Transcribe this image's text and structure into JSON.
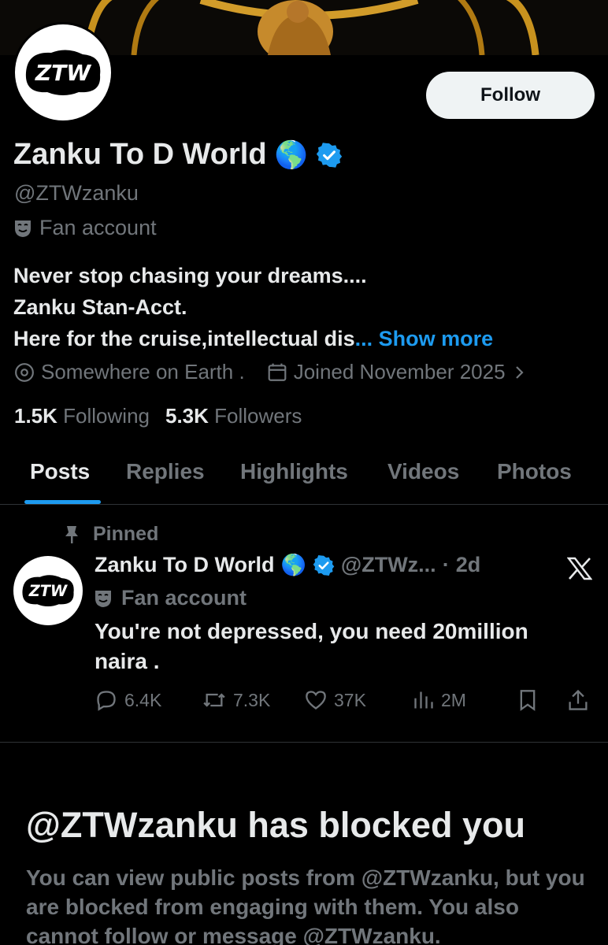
{
  "profile": {
    "display_name": "Zanku To D World",
    "name_emoji": "🌎",
    "handle": "@ZTWzanku",
    "category": "Fan account",
    "follow_label": "Follow",
    "avatar_text": "ZTW",
    "bio_line1": "Never stop chasing your dreams....",
    "bio_line2": "Zanku Stan-Acct.",
    "bio_line3": "Here for the cruise,intellectual dis",
    "bio_ellipsis": "...",
    "show_more": "Show more",
    "location": "Somewhere on Earth .",
    "joined": "Joined November 2025",
    "following_count": "1.5K",
    "following_label": "Following",
    "followers_count": "5.3K",
    "followers_label": "Followers"
  },
  "tabs": [
    {
      "label": "Posts",
      "active": true
    },
    {
      "label": "Replies",
      "active": false
    },
    {
      "label": "Highlights",
      "active": false
    },
    {
      "label": "Videos",
      "active": false
    },
    {
      "label": "Photos",
      "active": false
    }
  ],
  "pinned_post": {
    "pinned_label": "Pinned",
    "author": "Zanku To D World",
    "author_emoji": "🌎",
    "handle": "@ZTWz...",
    "dot": "·",
    "time": "2d",
    "category": "Fan account",
    "text": "You're not depressed, you need 20million naira .",
    "replies": "6.4K",
    "reposts": "7.3K",
    "likes": "37K",
    "views": "2M"
  },
  "blocked": {
    "title": "@ZTWzanku has blocked you",
    "description": "You can view public posts from @ZTWzanku, but you are blocked from engaging with them. You also cannot follow or message @ZTWzanku."
  },
  "colors": {
    "accent": "#1d9bf0",
    "background": "#000000",
    "text_primary": "#e7e9ea",
    "text_secondary": "#71767b",
    "banner_gold": "#c8921e"
  }
}
